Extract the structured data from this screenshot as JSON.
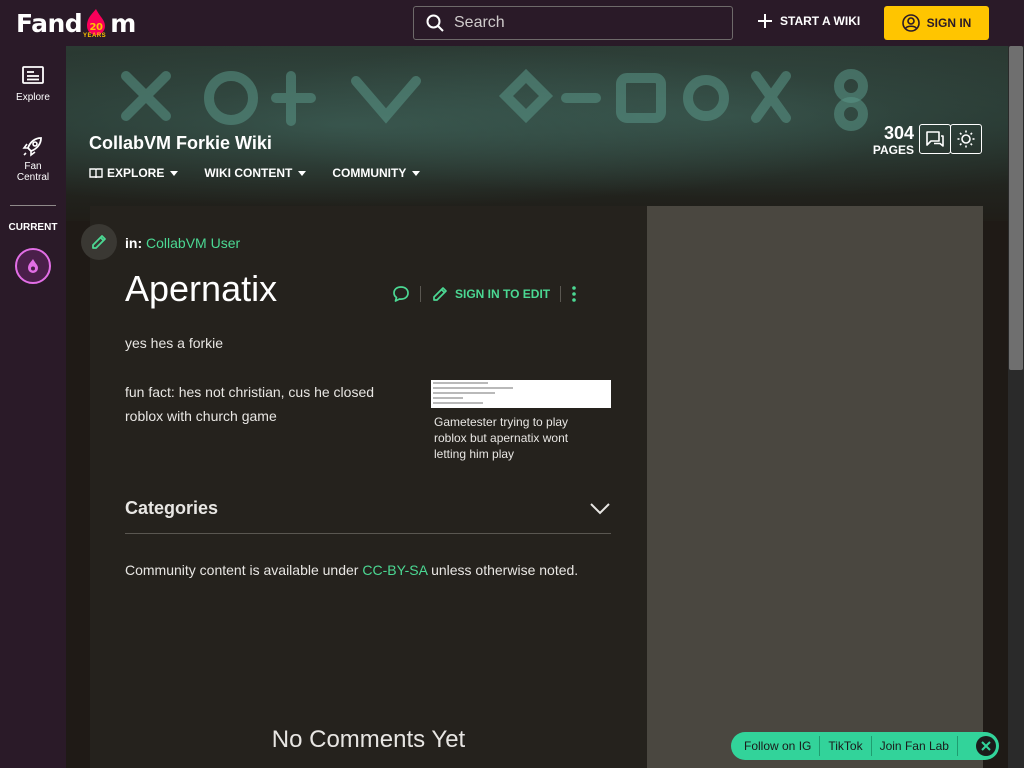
{
  "header": {
    "logo_text_a": "Fand",
    "logo_text_b": "m",
    "logo_badge": "20",
    "logo_years": "YEARS",
    "search_placeholder": "Search",
    "start_wiki": "START A WIKI",
    "sign_in": "SIGN IN",
    "accent": "#ffc500"
  },
  "rail": {
    "explore": "Explore",
    "fan_central_line1": "Fan",
    "fan_central_line2": "Central",
    "current": "CURRENT"
  },
  "wiki": {
    "title": "CollabVM Forkie Wiki",
    "nav": [
      "EXPLORE",
      "WIKI CONTENT",
      "COMMUNITY"
    ],
    "pages_count": "304",
    "pages_label": "PAGES"
  },
  "article": {
    "in_label": "in:",
    "category_link": "CollabVM User",
    "title": "Apernatix",
    "sign_in_to_edit": "SIGN IN TO EDIT",
    "para1": "yes hes a forkie",
    "para2_line1": "fun fact: hes not christian, cus he closed",
    "para2_line2": "roblox with church game",
    "image_caption_1": "Gametester trying to play",
    "image_caption_2": "roblox but apernatix wont",
    "image_caption_3": "letting him play",
    "categories_heading": "Categories",
    "license_prefix": "Community content is available under ",
    "license_link": "CC-BY-SA",
    "license_suffix": " unless otherwise noted.",
    "no_comments": "No Comments Yet",
    "link_color": "#4bd893"
  },
  "follow": {
    "items": [
      "Follow on IG",
      "TikTok",
      "Join Fan Lab"
    ],
    "color": "#32d39a"
  }
}
